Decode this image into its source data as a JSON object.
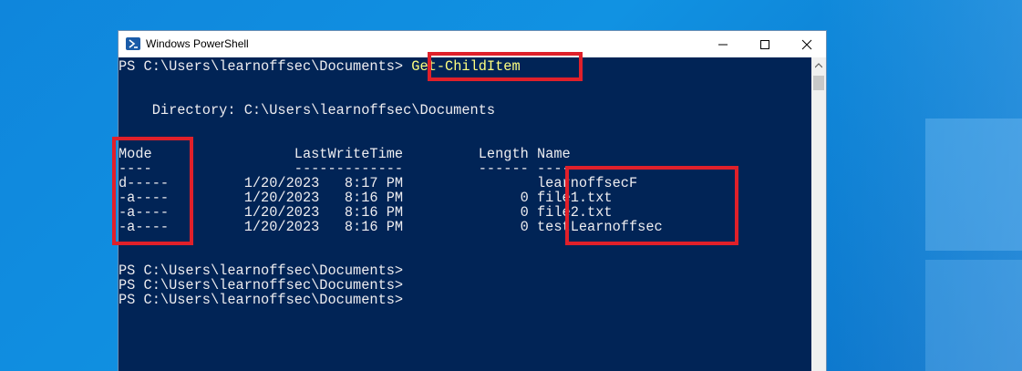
{
  "window": {
    "title": "Windows PowerShell"
  },
  "console": {
    "prompt": "PS C:\\Users\\learnoffsec\\Documents>",
    "command": "Get-ChildItem",
    "directory_line": "    Directory: C:\\Users\\learnoffsec\\Documents",
    "header": "Mode                 LastWriteTime         Length Name",
    "separator": "----                 -------------         ------ ----",
    "rows": [
      "d-----         1/20/2023   8:17 PM                learnoffsecF",
      "-a----         1/20/2023   8:16 PM              0 file1.txt",
      "-a----         1/20/2023   8:16 PM              0 file2.txt",
      "-a----         1/20/2023   8:16 PM              0 testLearnoffsec"
    ],
    "trailing_prompts": [
      "PS C:\\Users\\learnoffsec\\Documents>",
      "PS C:\\Users\\learnoffsec\\Documents>",
      "PS C:\\Users\\learnoffsec\\Documents>"
    ]
  },
  "colors": {
    "console_bg": "#012456",
    "console_fg": "#eeedf0",
    "command_fg": "#ffff80",
    "highlight": "#e0202a"
  }
}
